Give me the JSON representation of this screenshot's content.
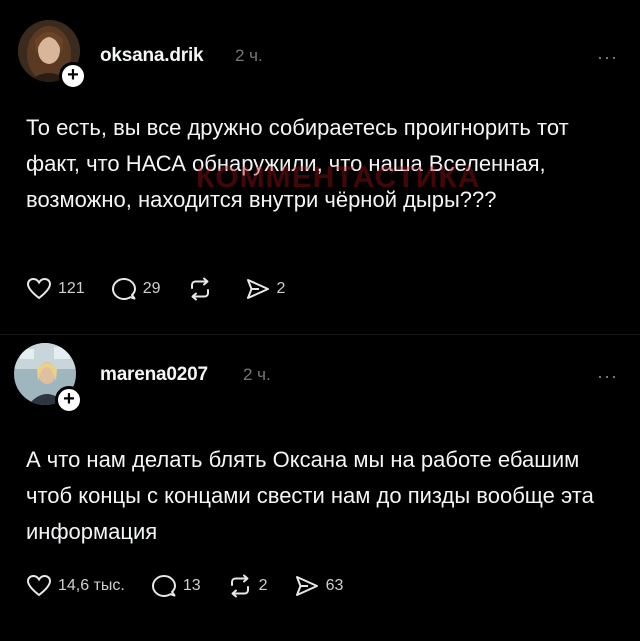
{
  "posts": [
    {
      "username": "oksana.drik",
      "time": "2 ч.",
      "more": "···",
      "text": "То есть, вы все дружно собираетесь проигнорить тот факт, что НАСА обнаружили, что наша Вселенная, возможно, находится внутри чёрной дыры???",
      "watermark": "КОММЕНТАСТИКА",
      "likes": "121",
      "replies": "29",
      "reposts": "",
      "shares": "2"
    },
    {
      "username": "marena0207",
      "time": "2 ч.",
      "more": "···",
      "text": "А что нам делать блять  Оксана мы на работе ебашим чтоб концы с концами свести нам до пизды вообще эта информация",
      "likes": "14,6 тыс.",
      "replies": "13",
      "reposts": "2",
      "shares": "63"
    }
  ],
  "icons": {
    "like": "heart-icon",
    "reply": "comment-icon",
    "repost": "repost-icon",
    "share": "send-icon",
    "follow": "plus-icon",
    "more": "more-icon"
  },
  "colors": {
    "background": "#000000",
    "text": "#f3f5f7",
    "muted": "#777777",
    "watermark": "#b1141a"
  }
}
